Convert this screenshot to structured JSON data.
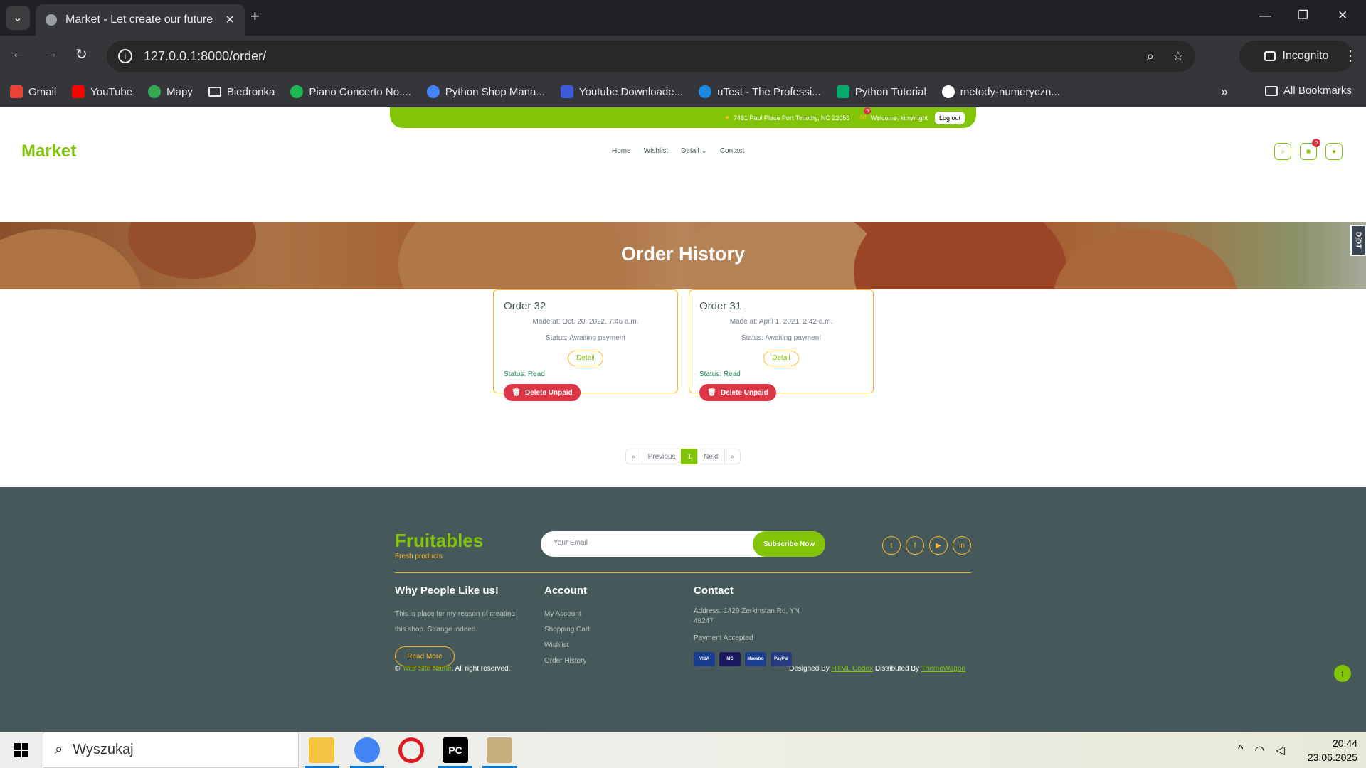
{
  "browser": {
    "tab_title": "Market - Let create our future",
    "url": "127.0.0.1:8000/order/",
    "incognito_label": "Incognito",
    "bookmarks": [
      {
        "label": "Gmail",
        "color": "#ea4335"
      },
      {
        "label": "YouTube",
        "color": "#ff0000"
      },
      {
        "label": "Mapy",
        "color": "#34a853"
      },
      {
        "label": "Biedronka",
        "color": "folder"
      },
      {
        "label": "Piano Concerto No....",
        "color": "#1db954"
      },
      {
        "label": "Python Shop Mana...",
        "color": "#4285f4"
      },
      {
        "label": "Youtube Downloade...",
        "color": "#3b5bdb"
      },
      {
        "label": "uTest - The Professi...",
        "color": "#1e88e5"
      },
      {
        "label": "Python Tutorial",
        "color": "#04aa6d"
      },
      {
        "label": "metody-numeryczn...",
        "color": "#ffffff"
      }
    ],
    "all_bookmarks": "All Bookmarks"
  },
  "topbar": {
    "address": "7481 Paul Place Port Timothy, NC 22056",
    "notif_count": "5",
    "welcome": "Welcome, kimwright",
    "logout": "Log out"
  },
  "header": {
    "logo": "Market",
    "nav": [
      "Home",
      "Wishlist",
      "Detail",
      "Contact"
    ],
    "cart_count": "0"
  },
  "hero": {
    "title": "Order History"
  },
  "debug_toolbar": "DjDT",
  "orders": [
    {
      "title": "Order 32",
      "made": "Made at: Oct. 20, 2022, 7:46 a.m.",
      "status": "Status: Awaiting payment",
      "detail": "Detail",
      "read": "Status: Read",
      "delete": "Delete Unpaid"
    },
    {
      "title": "Order 31",
      "made": "Made at: April 1, 2021, 2:42 a.m.",
      "status": "Status: Awaiting payment",
      "detail": "Detail",
      "read": "Status: Read",
      "delete": "Delete Unpaid"
    }
  ],
  "pagination": {
    "first": "«",
    "prev": "Previous",
    "current": "1",
    "next": "Next",
    "last": "»"
  },
  "footer": {
    "brand": "Fruitables",
    "tagline": "Fresh products",
    "email_placeholder": "Your Email",
    "subscribe": "Subscribe Now",
    "why_title": "Why People Like us!",
    "why_text": "This is place for my reason of creating this shop. Strange indeed.",
    "read_more": "Read More",
    "account_title": "Account",
    "account_links": [
      "My Account",
      "Shopping Cart",
      "Wishlist",
      "Order History"
    ],
    "contact_title": "Contact",
    "address": "Address: 1429 Zerkinstan Rd, YN 48247",
    "payment": "Payment Accepted",
    "cards": [
      "VISA",
      "MC",
      "Maestro",
      "PayPal"
    ],
    "site_name": "Your Site Name",
    "rights": ", All right reserved.",
    "designed_by": "Designed By",
    "html_codex": "HTML Codex",
    "distributed_by": "Distributed By",
    "themewagon": "ThemeWagon"
  },
  "taskbar": {
    "search_text": "Wyszukaj",
    "time": "20:44",
    "date": "23.06.2025"
  },
  "colors": {
    "primary": "#81c408",
    "secondary": "#ffb524",
    "footer_bg": "#45595b",
    "danger": "#dc3545"
  }
}
